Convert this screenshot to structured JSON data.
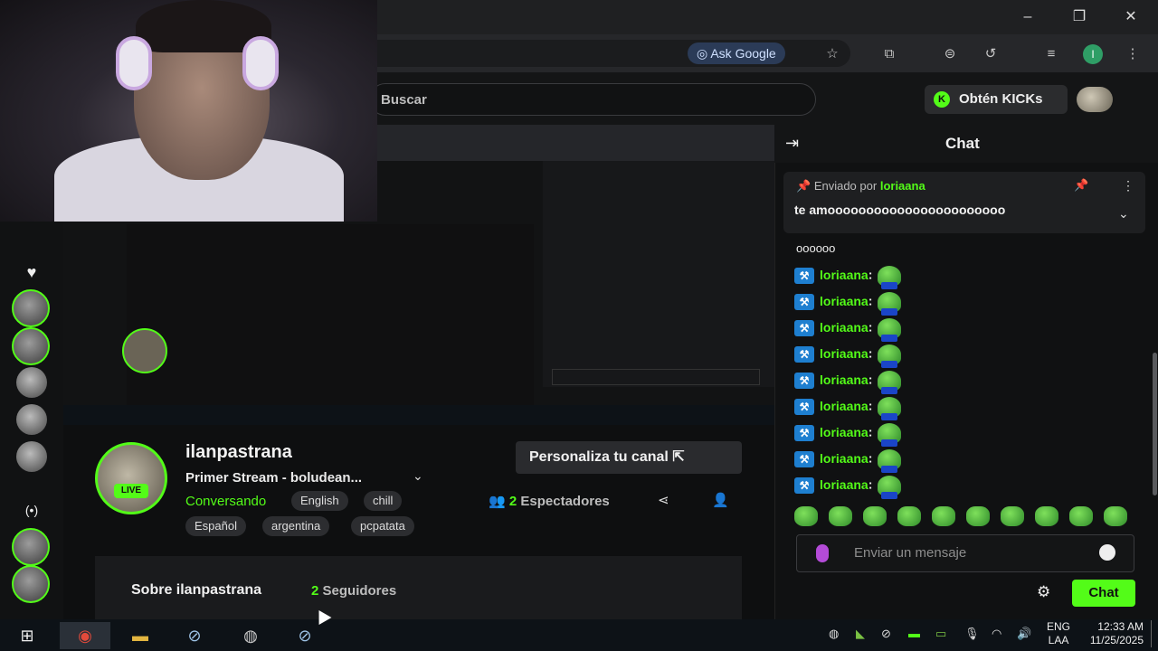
{
  "browser": {
    "ask_google": "Ask Google",
    "profile_initial": "I"
  },
  "kick": {
    "search_placeholder": "Buscar",
    "get_kicks": "Obtén KICKs",
    "kick_badge": "K"
  },
  "channel": {
    "name": "ilanpastrana",
    "stream_title": "Primer Stream - boludean...",
    "category": "Conversando",
    "live_label": "LIVE",
    "tags": [
      "English",
      "chill",
      "Español",
      "argentina",
      "pcpatata"
    ],
    "customize_button": "Personaliza tu canal",
    "viewers_count": "2",
    "viewers_label": "Espectadores",
    "about_title": "Sobre ilanpastrana",
    "followers_count": "2",
    "followers_label": "Seguidores"
  },
  "chat": {
    "title": "Chat",
    "pinned_by_label": "Enviado por",
    "pinned_by_user": "loriaana",
    "pinned_message": "te amooooooooooooooooooooooo",
    "continued_text": "oooooo",
    "messages": [
      {
        "user": "loriaana",
        "colon": ":"
      },
      {
        "user": "loriaana",
        "colon": ":"
      },
      {
        "user": "loriaana",
        "colon": ":"
      },
      {
        "user": "loriaana",
        "colon": ":"
      },
      {
        "user": "loriaana",
        "colon": ":"
      },
      {
        "user": "loriaana",
        "colon": ":"
      },
      {
        "user": "loriaana",
        "colon": ":"
      },
      {
        "user": "loriaana",
        "colon": ":"
      },
      {
        "user": "loriaana",
        "colon": ":"
      }
    ],
    "input_placeholder": "Enviar un mensaje",
    "send_button": "Chat"
  },
  "taskbar": {
    "language_top": "ENG",
    "language_bottom": "LAA",
    "time": "12:33 AM",
    "date": "11/25/2025"
  },
  "colors": {
    "accent": "#53fc18",
    "background": "#0c0d0e",
    "panel": "#1a1b1d"
  }
}
